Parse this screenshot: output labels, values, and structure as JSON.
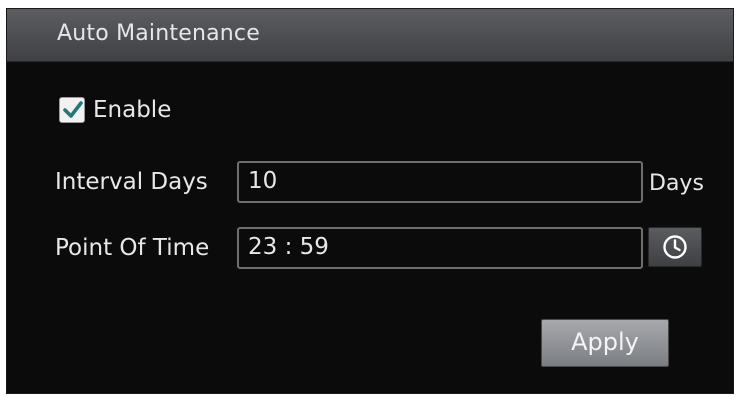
{
  "panel": {
    "title": "Auto Maintenance"
  },
  "enable": {
    "label": "Enable",
    "checked": true
  },
  "interval": {
    "label": "Interval Days",
    "value": "10",
    "unit": "Days"
  },
  "point_of_time": {
    "label": "Point Of Time",
    "value": "23 : 59",
    "icon": "clock-icon"
  },
  "actions": {
    "apply_label": "Apply"
  },
  "colors": {
    "checkbox_check": "#1f7a78",
    "panel_bg": "#0b0b0b",
    "header_bg": "#4a4c50"
  }
}
